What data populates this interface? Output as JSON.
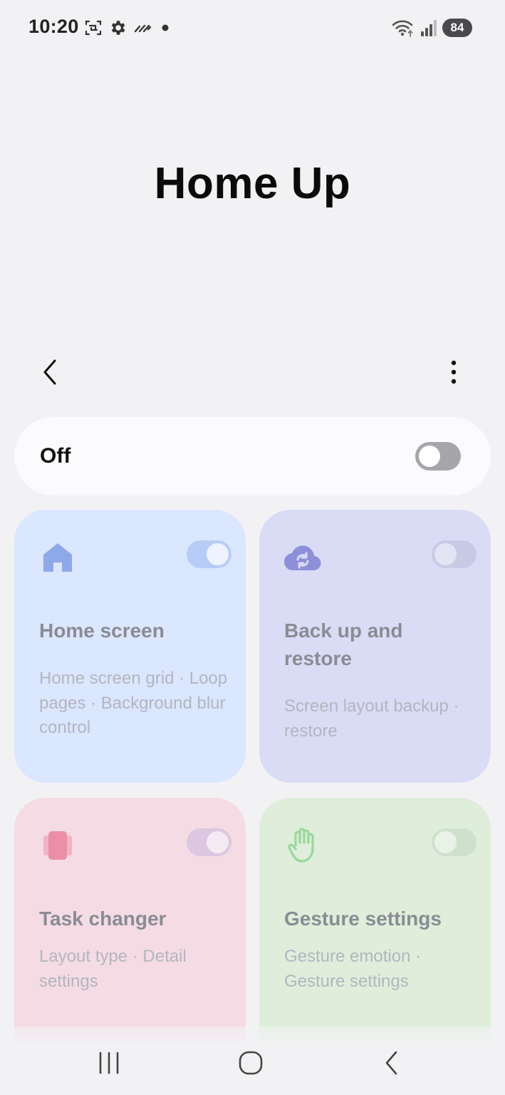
{
  "status_bar": {
    "time": "10:20",
    "left_icons": [
      "screenshot-icon",
      "gear-icon",
      "slashes-icon",
      "dot-icon"
    ],
    "right_icons": [
      "wifi-icon",
      "signal-icon"
    ],
    "battery": "84"
  },
  "page": {
    "title": "Home Up"
  },
  "master_switch": {
    "label": "Off",
    "state": "off"
  },
  "cards": [
    {
      "title": "Home screen",
      "description": "Home screen grid · Loop pages · Background blur control",
      "icon": "home-icon",
      "toggle_state": "on",
      "color": "#dbe6ff"
    },
    {
      "title": "Back up and restore",
      "description": "Screen layout backup · restore",
      "icon": "cloud-sync-icon",
      "toggle_state": "off",
      "color": "#dadcf6"
    },
    {
      "title": "Task changer",
      "description": "Layout type · Detail settings",
      "icon": "task-stack-icon",
      "toggle_state": "on",
      "color": "#f5dbe4"
    },
    {
      "title": "Gesture settings",
      "description": "Gesture emotion · Gesture settings",
      "icon": "hand-icon",
      "toggle_state": "off",
      "color": "#deeedb"
    }
  ],
  "nav": {
    "buttons": [
      "recents-icon",
      "home-icon",
      "back-icon"
    ]
  },
  "colors": {
    "background": "#f2f2f4",
    "accent_blue": "#8ea9ea",
    "accent_lavender": "#8d90d8",
    "accent_pink": "#eb8ea6",
    "accent_green": "#9ad79b"
  }
}
